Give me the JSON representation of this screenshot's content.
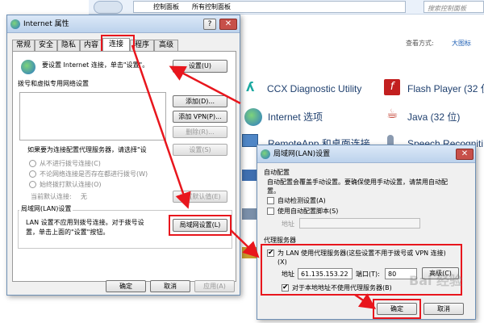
{
  "control_panel": {
    "breadcrumb_1": "控制面板",
    "breadcrumb_2": "所有控制面板",
    "search_placeholder": "搜索控制面板",
    "view_label": "查看方式:",
    "view_value": "大图标",
    "items": [
      {
        "label": "CCX Diagnostic Utility"
      },
      {
        "label": "Flash Player (32 位"
      },
      {
        "label": "Internet 选项"
      },
      {
        "label": "Java (32 位)"
      },
      {
        "label": "RemoteApp 和桌面连接"
      },
      {
        "label": "Speech Recogniti"
      }
    ]
  },
  "internet_props": {
    "title": "Internet 属性",
    "tabs": [
      {
        "label": "常规"
      },
      {
        "label": "安全"
      },
      {
        "label": "隐私"
      },
      {
        "label": "内容"
      },
      {
        "label": "连接"
      },
      {
        "label": "程序"
      },
      {
        "label": "高级"
      }
    ],
    "setup_text": "要设置 Internet 连接，单击\"设置\"。",
    "setup_button": "设置(U)",
    "dialup_header": "拨号和虚拟专用网络设置",
    "add_button": "添加(D)...",
    "add_vpn_button": "添加 VPN(P)...",
    "remove_button": "删除(R)...",
    "proxy_text": "如果要为连接配置代理服务器，请选择\"设",
    "settings_button": "设置(S)",
    "radio_never": "从不进行拨号连接(C)",
    "radio_when_no_network": "不论网络连接是否存在都进行拨号(W)",
    "radio_always": "始终拨打默认连接(O)",
    "current_default_label": "当前默认连接:",
    "current_default_value": "无",
    "set_default_button": "设置默认值(E)",
    "lan_group_title": "局域网(LAN)设置",
    "lan_text_1": "LAN 设置不应用到拨号连接。对于拨号设",
    "lan_text_2": "置，单击上面的\"设置\"按钮。",
    "lan_settings_button": "局域网设置(L)",
    "ok_button": "确定",
    "cancel_button": "取消",
    "apply_button": "应用(A)"
  },
  "lan_dialog": {
    "title": "局域网(LAN)设置",
    "auto_config_header": "自动配置",
    "auto_config_text_1": "自动配置会覆盖手动设置。要确保使用手动设置，请禁用自动配",
    "auto_config_text_2": "置。",
    "auto_detect_label": "自动检测设置(A)",
    "use_script_label": "使用自动配置脚本(S)",
    "address_label": "地址",
    "proxy_header": "代理服务器",
    "use_proxy_label_1": "为 LAN 使用代理服务器(这些设置不用于拨号或 VPN 连接)",
    "use_proxy_label_2": "(X)",
    "proxy_address_label": "地址",
    "proxy_address_value": "61.135.153.22",
    "port_label": "端口(T):",
    "port_value": "80",
    "advanced_button": "高级(C)",
    "bypass_label": "对于本地地址不使用代理服务器(B)",
    "ok_button": "确定",
    "cancel_button": "取消",
    "watermark": "Bai 经验"
  },
  "colors": {
    "highlight_red": "#e8161d",
    "link_blue": "#1e3f6e"
  }
}
